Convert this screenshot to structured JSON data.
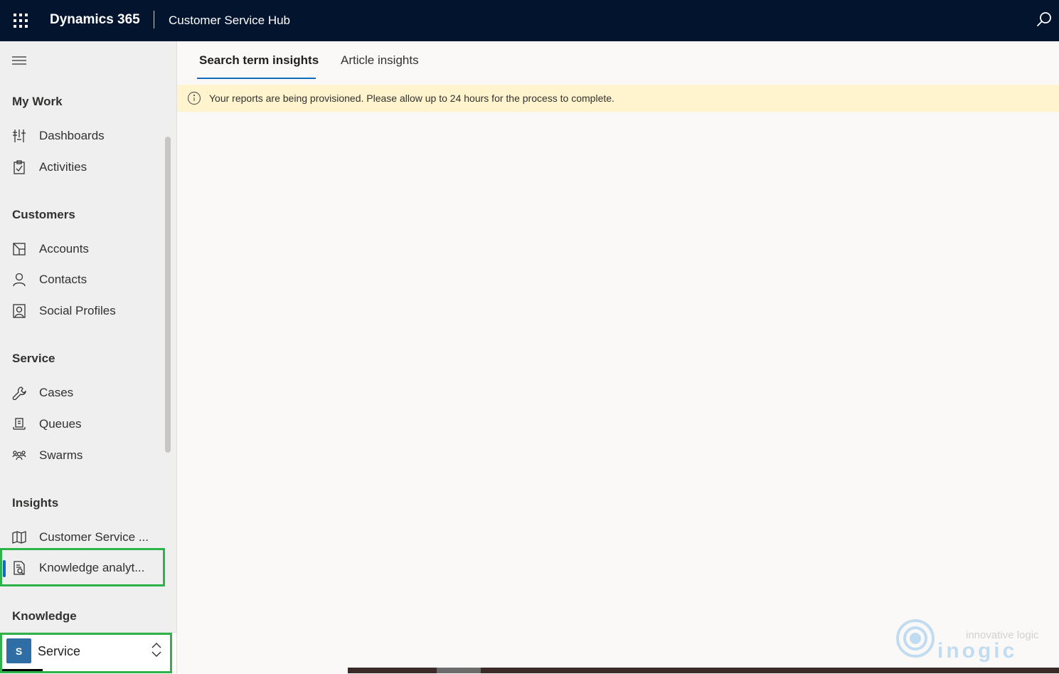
{
  "topbar": {
    "brand": "Dynamics 365",
    "app_title": "Customer Service Hub",
    "icons": {
      "app_launcher": "waffle-icon",
      "search": "search-icon"
    },
    "background_color": "#03142e"
  },
  "sidebar": {
    "sections": [
      {
        "title": "My Work",
        "items": [
          {
            "label": "Dashboards",
            "icon": "dashboard-icon"
          },
          {
            "label": "Activities",
            "icon": "clipboard-icon"
          }
        ]
      },
      {
        "title": "Customers",
        "items": [
          {
            "label": "Accounts",
            "icon": "account-icon"
          },
          {
            "label": "Contacts",
            "icon": "person-icon"
          },
          {
            "label": "Social Profiles",
            "icon": "social-profile-icon"
          }
        ]
      },
      {
        "title": "Service",
        "items": [
          {
            "label": "Cases",
            "icon": "wrench-icon"
          },
          {
            "label": "Queues",
            "icon": "queue-icon"
          },
          {
            "label": "Swarms",
            "icon": "people-icon"
          }
        ]
      },
      {
        "title": "Insights",
        "items": [
          {
            "label": "Customer Service ...",
            "icon": "book-icon"
          },
          {
            "label": "Knowledge analyt...",
            "icon": "knowledge-report-icon",
            "selected": true
          }
        ]
      },
      {
        "title": "Knowledge",
        "items": []
      }
    ],
    "area_switcher": {
      "avatar": "S",
      "label": "Service",
      "icon": "chevron-updown-icon"
    },
    "highlight_color": "#2eb24a"
  },
  "main": {
    "tabs": [
      {
        "label": "Search term insights",
        "active": true
      },
      {
        "label": "Article insights",
        "active": false
      }
    ],
    "banner": {
      "icon": "info-icon",
      "message": "Your reports are being provisioned. Please allow up to 24 hours for the process to complete.",
      "background_color": "#fff4ce"
    }
  },
  "watermark": {
    "tagline": "innovative logic",
    "name": "inogic"
  }
}
